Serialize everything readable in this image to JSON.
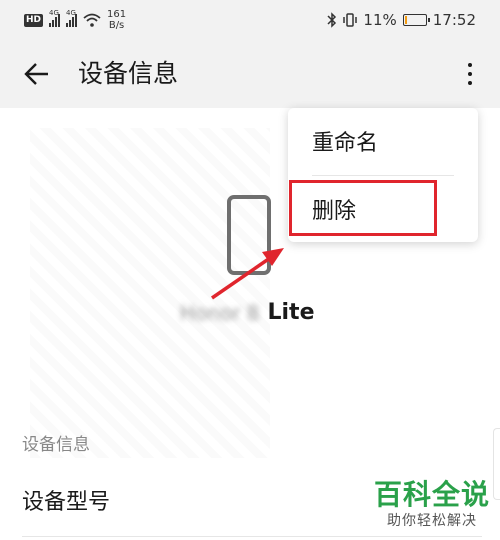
{
  "status_bar": {
    "hd": "HD",
    "net1": "4G",
    "net2": "4G",
    "speed_value": "161",
    "speed_unit": "B/s",
    "battery_text": "11%",
    "battery_level": 0.11,
    "time": "17:52",
    "icons": [
      "signal-icon",
      "wifi-icon",
      "bluetooth-icon",
      "vibrate-icon",
      "battery-icon"
    ]
  },
  "app_bar": {
    "title": "设备信息"
  },
  "device": {
    "name_blurred": "Honor 8",
    "name_suffix": "Lite"
  },
  "section_label": "设备信息",
  "row_model": "设备型号",
  "menu": {
    "items": [
      {
        "label": "重命名"
      },
      {
        "label": "删除"
      }
    ]
  },
  "watermark": {
    "title": "百科全说",
    "subtitle": "助你轻松解决"
  },
  "colors": {
    "highlight": "#e0252d",
    "watermark": "#2aa14a",
    "battery": "#f39c12"
  }
}
